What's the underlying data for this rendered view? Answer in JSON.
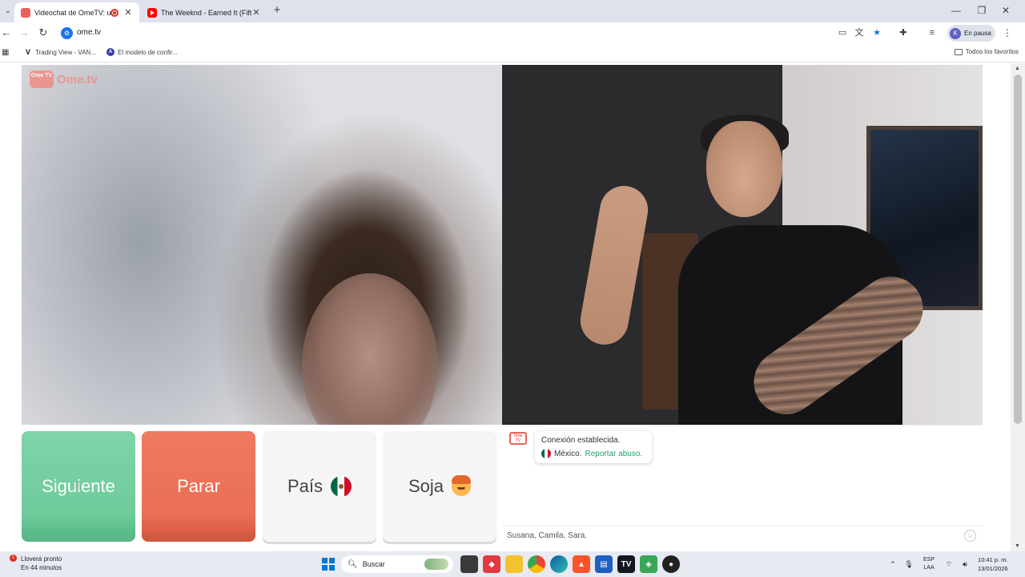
{
  "browser": {
    "tabs": [
      {
        "title": "Videochat de OmeTV: una c",
        "active": true
      },
      {
        "title": "The Weeknd - Earned It (Fifty S",
        "active": false
      }
    ],
    "url": "ome.tv",
    "profile_status": "En pausa",
    "profile_initial": "K",
    "bookmarks": [
      {
        "label": "Trading View - VAN..."
      },
      {
        "label": "El modelo de confir..."
      }
    ],
    "all_bookmarks": "Todos los favoritos"
  },
  "site": {
    "logo_text": "Ome.tv",
    "logo_box": "Ome TV",
    "buttons": {
      "next": "Siguiente",
      "stop": "Parar",
      "country": "País",
      "gender": "Soja"
    },
    "chat": {
      "status": "Conexión establecida.",
      "country": "México",
      "separator": " .",
      "report": "Reportar abuso.",
      "input_value": "Susana, Camila, Sara."
    }
  },
  "taskbar": {
    "weather_line1": "Lloverá pronto",
    "weather_line2": "En 44 minutos",
    "weather_badge": "1",
    "search_label": "Buscar",
    "language_line1": "ESP",
    "language_line2": "LAA",
    "time": "10:41 p. m.",
    "date": "13/01/2026"
  },
  "colors": {
    "next_button": "#6fcb9b",
    "stop_button": "#e96f55",
    "accent": "#22a06b",
    "brand": "#e8625a"
  }
}
